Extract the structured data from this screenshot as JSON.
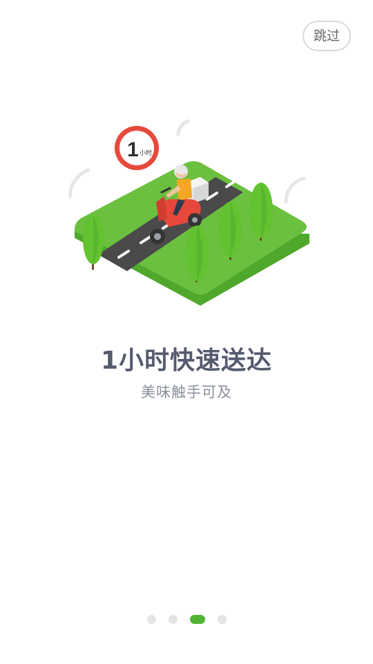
{
  "header": {
    "skip_label": "跳过"
  },
  "illustration": {
    "sign_number": "1",
    "sign_unit": "小时",
    "icon": "delivery-scooter-illustration"
  },
  "content": {
    "title": "1小时快速送达",
    "subtitle": "美味触手可及"
  },
  "pager": {
    "total_pages": 4,
    "current_page": 3
  },
  "colors": {
    "accent_green": "#52b334",
    "grass": "#6cc03f",
    "road": "#4a4a4a",
    "sign_red": "#e64a3c",
    "scooter_red": "#e8473b",
    "title_text": "#555b6e",
    "subtitle_text": "#8a8f9c"
  }
}
